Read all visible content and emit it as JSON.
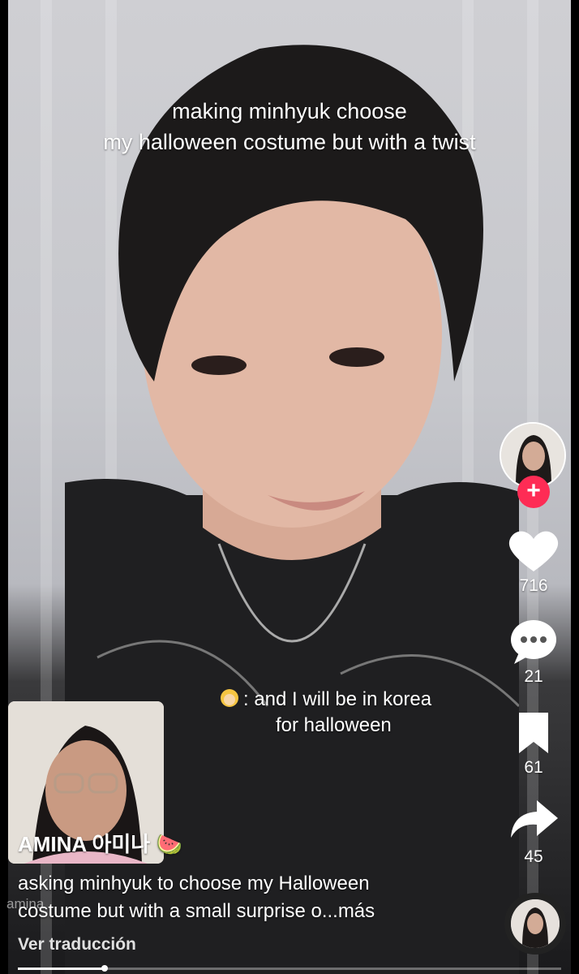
{
  "video": {
    "caption_top": [
      "making minhyuk choose",
      "my halloween costume but with a twist"
    ],
    "caption_mid_line1": ": and I will be in korea",
    "caption_mid_line2": "for halloween",
    "progress": 0.16
  },
  "side_actions": {
    "likes": "716",
    "comments": "21",
    "saves": "61",
    "shares": "45"
  },
  "post": {
    "username": "AMINA 아미나 🍉",
    "description_line1": "asking minhyuk to choose my Halloween",
    "description_line2": "costume but with a small surprise o...más",
    "translate": "Ver traducción",
    "watermark": "amina"
  },
  "colors": {
    "follow": "#fe2c55",
    "text": "#ffffff"
  }
}
